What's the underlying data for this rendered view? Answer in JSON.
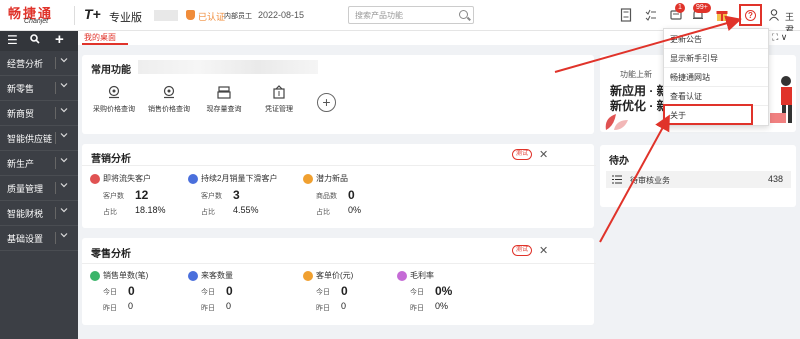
{
  "app": {
    "logo_cn": "畅捷通",
    "logo_en": "Chanjet",
    "brand": "T+",
    "edition": "专业版",
    "verified": "已认证",
    "company": "内部员工",
    "date": "2022-08-15",
    "search_placeholder": "搜索产品功能",
    "badge_msg": "1",
    "badge_notice": "99+",
    "help_glyph": "?",
    "user_name": "王君"
  },
  "sidebar": {
    "tools": [
      "☰",
      "🔍",
      "+"
    ],
    "items": [
      {
        "label": "经营分析"
      },
      {
        "label": "新零售"
      },
      {
        "label": "新商贸"
      },
      {
        "label": "智能供应链"
      },
      {
        "label": "新生产"
      },
      {
        "label": "质量管理"
      },
      {
        "label": "智能财税"
      },
      {
        "label": "基础设置"
      }
    ]
  },
  "tabs": {
    "home": "我的桌面",
    "tools": "⛶ ∨"
  },
  "common": {
    "title": "常用功能",
    "shortcuts": [
      {
        "label": "采购价格查询",
        "icon": "price-search-icon"
      },
      {
        "label": "销售价格查询",
        "icon": "price-search-icon"
      },
      {
        "label": "现存量查询",
        "icon": "stock-icon"
      },
      {
        "label": "凭证管理",
        "icon": "voucher-icon"
      }
    ],
    "add": "+"
  },
  "marketing": {
    "title": "营销分析",
    "pill": "测试",
    "close": "✕",
    "metrics": [
      {
        "title": "即将流失客户",
        "k1": "客户数",
        "v1": "12",
        "k2": "占比",
        "v2": "18.18%",
        "color": "#e05252"
      },
      {
        "title": "持续2月销量下滑客户",
        "k1": "客户数",
        "v1": "3",
        "k2": "占比",
        "v2": "4.55%",
        "color": "#4a6fdc"
      },
      {
        "title": "潜力新品",
        "k1": "商品数",
        "v1": "0",
        "k2": "占比",
        "v2": "0%",
        "color": "#f0a030"
      }
    ]
  },
  "retail": {
    "title": "零售分析",
    "pill": "测试",
    "close": "✕",
    "metrics": [
      {
        "title": "销售单数(笔)",
        "k1": "今日",
        "v1": "0",
        "k2": "昨日",
        "v2": "0",
        "color": "#3bb56a"
      },
      {
        "title": "来客数量",
        "k1": "今日",
        "v1": "0",
        "k2": "昨日",
        "v2": "0",
        "color": "#4a6fdc"
      },
      {
        "title": "客单价(元)",
        "k1": "今日",
        "v1": "0",
        "k2": "昨日",
        "v2": "0",
        "color": "#f0a030"
      },
      {
        "title": "毛利率",
        "k1": "今日",
        "v1": "0%",
        "k2": "昨日",
        "v2": "0%",
        "color": "#c56bd6"
      }
    ]
  },
  "banner": {
    "line0": "功能上新",
    "line1": "新应用 · 新",
    "line2": "新优化 · 新"
  },
  "todo": {
    "title": "待办",
    "item": "待审核业务",
    "count": "438"
  },
  "dropdown": {
    "items": [
      "更新公告",
      "显示新手引导",
      "畅捷通网站",
      "查看认证",
      "关于"
    ]
  },
  "colors": {
    "accent": "#e0332a",
    "sidebar": "#3c3f45"
  }
}
